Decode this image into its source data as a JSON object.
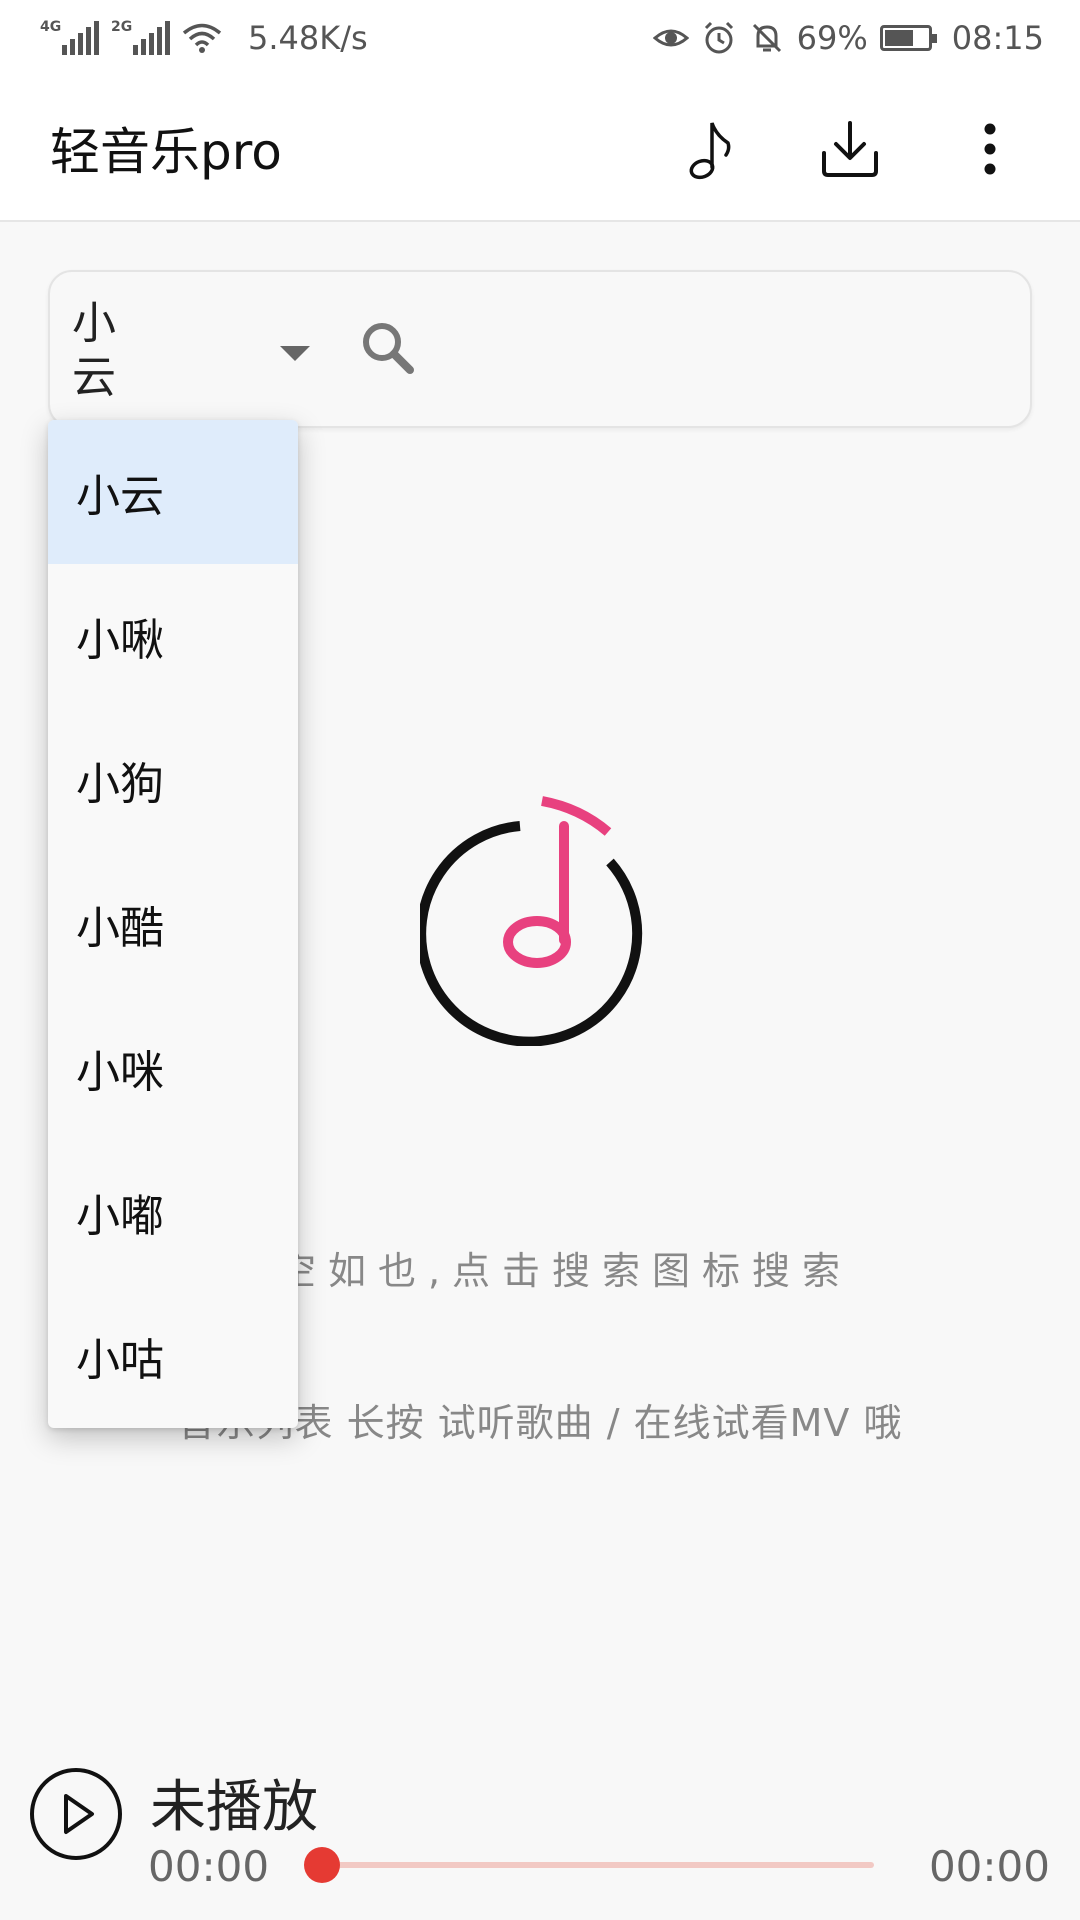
{
  "status_bar": {
    "signal_1_tag": "4G",
    "signal_2_tag": "2G",
    "net_speed": "5.48K/s",
    "battery": "69%",
    "battery_level": 0.69,
    "time": "08:15",
    "icons": [
      "eye-icon",
      "alarm-icon",
      "mute-bell-icon",
      "battery-charging-icon"
    ]
  },
  "app_bar": {
    "title": "轻音乐pro",
    "actions": [
      "music-note-icon",
      "download-icon",
      "more-vert-icon"
    ]
  },
  "search": {
    "selected_source": "小云",
    "icon": "search-icon"
  },
  "dropdown": {
    "selected_index": 0,
    "options": [
      "小云",
      "小啾",
      "小狗",
      "小酷",
      "小咪",
      "小嘟",
      "小咕"
    ]
  },
  "empty_state": {
    "line1": "空空如也,点击搜索图标搜索",
    "line2": "音乐列表 长按 试听歌曲 / 在线试看MV 哦",
    "logo_accent": "#e8417f"
  },
  "player": {
    "title": "未播放",
    "current_time": "00:00",
    "total_time": "00:00",
    "progress": 0,
    "accent": "#e53a33"
  }
}
